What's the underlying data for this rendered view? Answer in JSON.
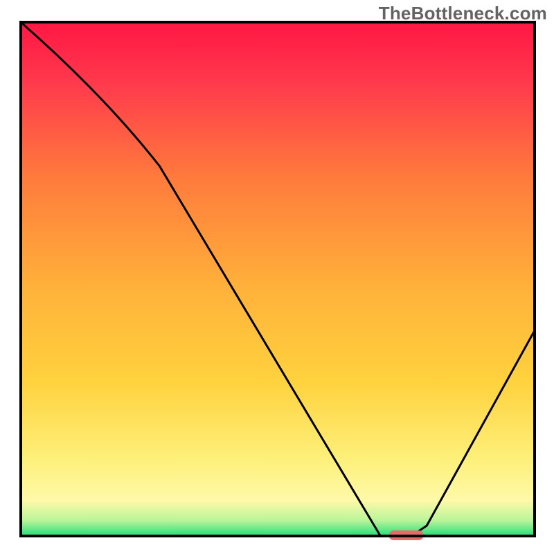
{
  "watermark": "TheBottleneck.com",
  "chart_data": {
    "type": "line",
    "title": "",
    "xlabel": "",
    "ylabel": "",
    "xlim": [
      0,
      100
    ],
    "ylim": [
      0,
      100
    ],
    "x": [
      0,
      27,
      70,
      76,
      79,
      100
    ],
    "values": [
      100,
      72,
      0,
      0,
      2,
      40
    ],
    "marker": {
      "x_center": 75,
      "y_value": 0
    },
    "colors": {
      "gradient_top": "#ff1744",
      "gradient_mid_upper": "#ff7a3c",
      "gradient_mid": "#ffd23e",
      "gradient_low": "#fff9a8",
      "gradient_bottom": "#1ee07a",
      "curve": "#000000",
      "marker": "#e96a6a",
      "frame": "#000000"
    }
  }
}
